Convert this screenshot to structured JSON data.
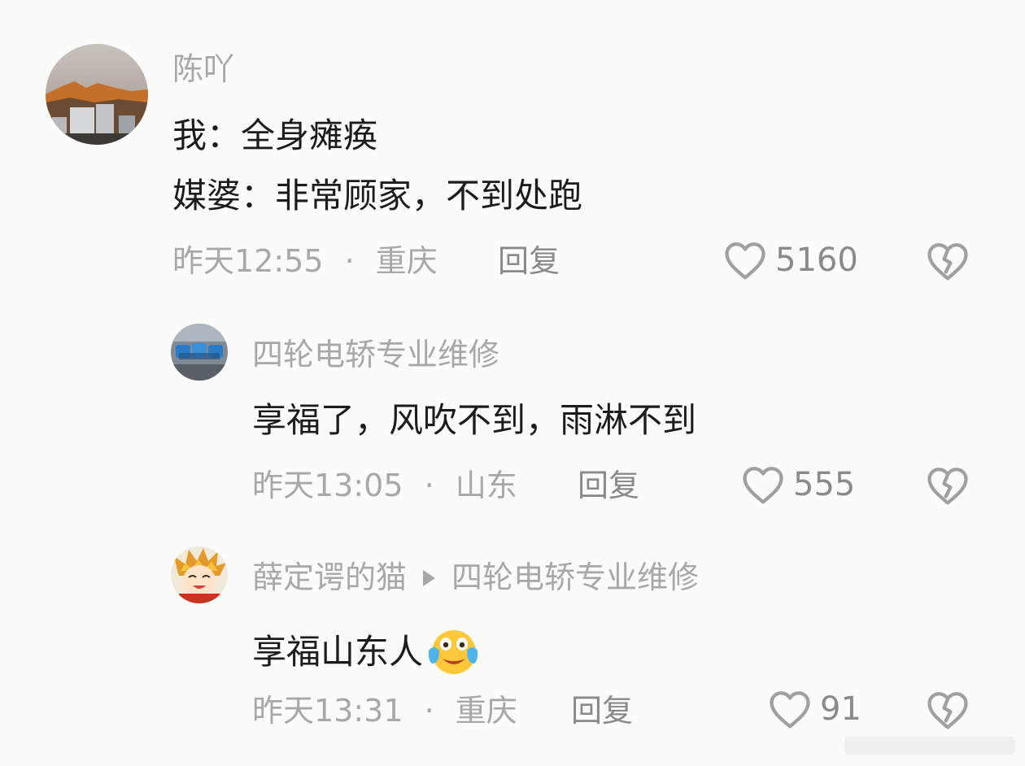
{
  "comments": [
    {
      "username": "陈吖",
      "lines": [
        "我：全身瘫痪",
        "媒婆：非常顾家，不到处跑"
      ],
      "time": "昨天12:55",
      "dot": "·",
      "location": "重庆",
      "reply_label": "回复",
      "likes": "5160"
    },
    {
      "username": "四轮电轿专业维修",
      "lines": [
        "享福了，风吹不到，雨淋不到"
      ],
      "time": "昨天13:05",
      "dot": "·",
      "location": "山东",
      "reply_label": "回复",
      "likes": "555"
    },
    {
      "username": "薛定谔的猫",
      "reply_to": "四轮电轿专业维修",
      "lines": [
        "享福山东人"
      ],
      "time": "昨天13:31",
      "dot": "·",
      "location": "重庆",
      "reply_label": "回复",
      "likes": "91"
    }
  ],
  "icons": {
    "like": "heart-outline-icon",
    "dislike": "broken-heart-icon",
    "emoji": "crying-laughing-emoji",
    "reply_arrow": "play-arrow-icon"
  },
  "colors": {
    "background": "#fbfbf9",
    "text": "#1c1c1c",
    "muted": "#a8a8a8"
  }
}
